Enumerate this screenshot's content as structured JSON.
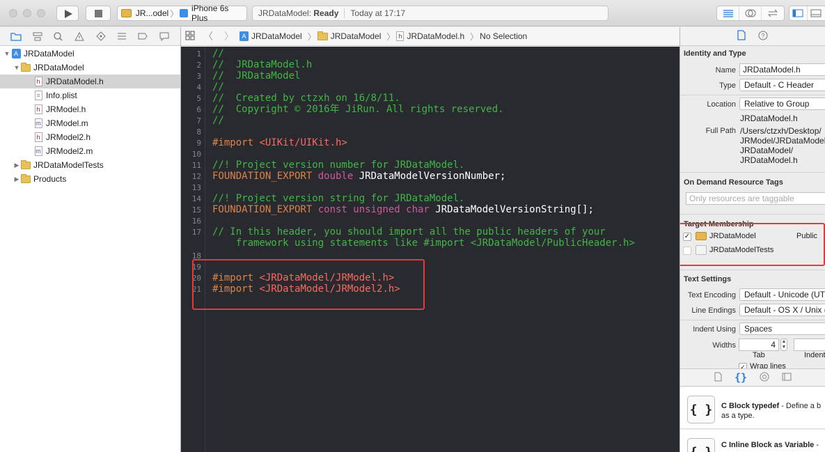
{
  "toolbar": {
    "scheme": {
      "project": "JR...odel",
      "device": "iPhone 6s Plus"
    },
    "status": {
      "project": "JRDataModel:",
      "state": "Ready",
      "time": "Today at 17:17"
    }
  },
  "navigator": {
    "tree": [
      {
        "label": "JRDataModel",
        "icon": "project-icon",
        "level": 0,
        "expanded": true
      },
      {
        "label": "JRDataModel",
        "icon": "folder-icon",
        "level": 1,
        "expanded": true
      },
      {
        "label": "JRDataModel.h",
        "icon": "header-file-icon",
        "glyph": "h",
        "level": 2,
        "selected": true
      },
      {
        "label": "Info.plist",
        "icon": "plist-file-icon",
        "glyph": "",
        "level": 2
      },
      {
        "label": "JRModel.h",
        "icon": "header-file-icon",
        "glyph": "h",
        "level": 2
      },
      {
        "label": "JRModel.m",
        "icon": "implementation-file-icon",
        "glyph": "m",
        "level": 2
      },
      {
        "label": "JRModel2.h",
        "icon": "header-file-icon",
        "glyph": "h",
        "level": 2
      },
      {
        "label": "JRModel2.m",
        "icon": "implementation-file-icon",
        "glyph": "m",
        "level": 2
      },
      {
        "label": "JRDataModelTests",
        "icon": "folder-icon",
        "level": 1,
        "expanded": false
      },
      {
        "label": "Products",
        "icon": "folder-icon",
        "level": 1,
        "expanded": false
      }
    ]
  },
  "jumpbar": {
    "project": "JRDataModel",
    "group": "JRDataModel",
    "file": "JRDataModel.h",
    "symbol": "No Selection"
  },
  "editor": {
    "lines": [
      {
        "n": "1",
        "parts": [
          [
            "cm",
            "//"
          ]
        ]
      },
      {
        "n": "2",
        "parts": [
          [
            "cm",
            "//  JRDataModel.h"
          ]
        ]
      },
      {
        "n": "3",
        "parts": [
          [
            "cm",
            "//  JRDataModel"
          ]
        ]
      },
      {
        "n": "4",
        "parts": [
          [
            "cm",
            "//"
          ]
        ]
      },
      {
        "n": "5",
        "parts": [
          [
            "cm",
            "//  Created by ctzxh on 16/8/11."
          ]
        ]
      },
      {
        "n": "6",
        "parts": [
          [
            "cm",
            "//  Copyright © 2016年 JiRun. All rights reserved."
          ]
        ]
      },
      {
        "n": "7",
        "parts": [
          [
            "cm",
            "//"
          ]
        ]
      },
      {
        "n": "8",
        "parts": []
      },
      {
        "n": "9",
        "parts": [
          [
            "pp",
            "#import "
          ],
          [
            "str",
            "<UIKit/UIKit.h>"
          ]
        ]
      },
      {
        "n": "10",
        "parts": []
      },
      {
        "n": "11",
        "parts": [
          [
            "cm",
            "//! Project version number for JRDataModel."
          ]
        ]
      },
      {
        "n": "12",
        "parts": [
          [
            "pp",
            "FOUNDATION_EXPORT "
          ],
          [
            "kw",
            "double "
          ],
          [
            "pl",
            "JRDataModelVersionNumber;"
          ]
        ]
      },
      {
        "n": "13",
        "parts": []
      },
      {
        "n": "14",
        "parts": [
          [
            "cm",
            "//! Project version string for JRDataModel."
          ]
        ]
      },
      {
        "n": "15",
        "parts": [
          [
            "pp",
            "FOUNDATION_EXPORT "
          ],
          [
            "kw",
            "const unsigned char "
          ],
          [
            "pl",
            "JRDataModelVersionString[];"
          ]
        ]
      },
      {
        "n": "16",
        "parts": []
      },
      {
        "n": "17",
        "parts": [
          [
            "cm",
            "// In this header, you should import all the public headers of your"
          ]
        ]
      },
      {
        "n": "",
        "parts": [
          [
            "cm",
            "    framework using statements like #import <JRDataModel/PublicHeader.h>"
          ]
        ]
      },
      {
        "n": "18",
        "parts": []
      },
      {
        "n": "19",
        "parts": []
      },
      {
        "n": "20",
        "parts": [
          [
            "pp",
            "#import "
          ],
          [
            "str",
            "<JRDataModel/JRModel.h>"
          ]
        ]
      },
      {
        "n": "21",
        "parts": [
          [
            "pp",
            "#import "
          ],
          [
            "str",
            "<JRDataModel/JRModel2.h>"
          ]
        ]
      }
    ]
  },
  "inspector": {
    "identity": {
      "title": "Identity and Type",
      "name_label": "Name",
      "name_value": "JRDataModel.h",
      "type_label": "Type",
      "type_value": "Default - C Header",
      "location_label": "Location",
      "location_value": "Relative to Group",
      "location_path": "JRDataModel.h",
      "fullpath_label": "Full Path",
      "fullpath_lines": [
        "/Users/ctzxh/Desktop/",
        "JRModel/JRDataModel/",
        "JRDataModel/",
        "JRDataModel.h"
      ]
    },
    "ondemand": {
      "title": "On Demand Resource Tags",
      "placeholder": "Only resources are taggable"
    },
    "target": {
      "title": "Target Membership",
      "items": [
        {
          "label": "JRDataModel",
          "checked": true,
          "visibility": "Public"
        },
        {
          "label": "JRDataModelTests",
          "checked": false,
          "visibility": ""
        }
      ]
    },
    "text": {
      "title": "Text Settings",
      "encoding_label": "Text Encoding",
      "encoding_value": "Default - Unicode (UTF",
      "endings_label": "Line Endings",
      "endings_value": "Default - OS X / Unix (.",
      "indent_label": "Indent Using",
      "indent_value": "Spaces",
      "widths_label": "Widths",
      "tab_value": "4",
      "tab_label": "Tab",
      "indent_caption": "Indent",
      "wrap_label": "Wrap lines"
    },
    "library": [
      {
        "icon_text": "{ }",
        "title": "C Block typedef",
        "desc1": " - Define a b",
        "desc2": "as a type."
      },
      {
        "icon_text": "{ }",
        "title": "C Inline Block as Variable",
        "desc1": " -",
        "desc2": ""
      }
    ]
  },
  "colors": {
    "highlight": "#e23b3b",
    "editor_bg": "#292a30",
    "comment": "#41b645",
    "keyword": "#d0589d",
    "preprocessor": "#db8549",
    "string": "#fc6a5d"
  }
}
